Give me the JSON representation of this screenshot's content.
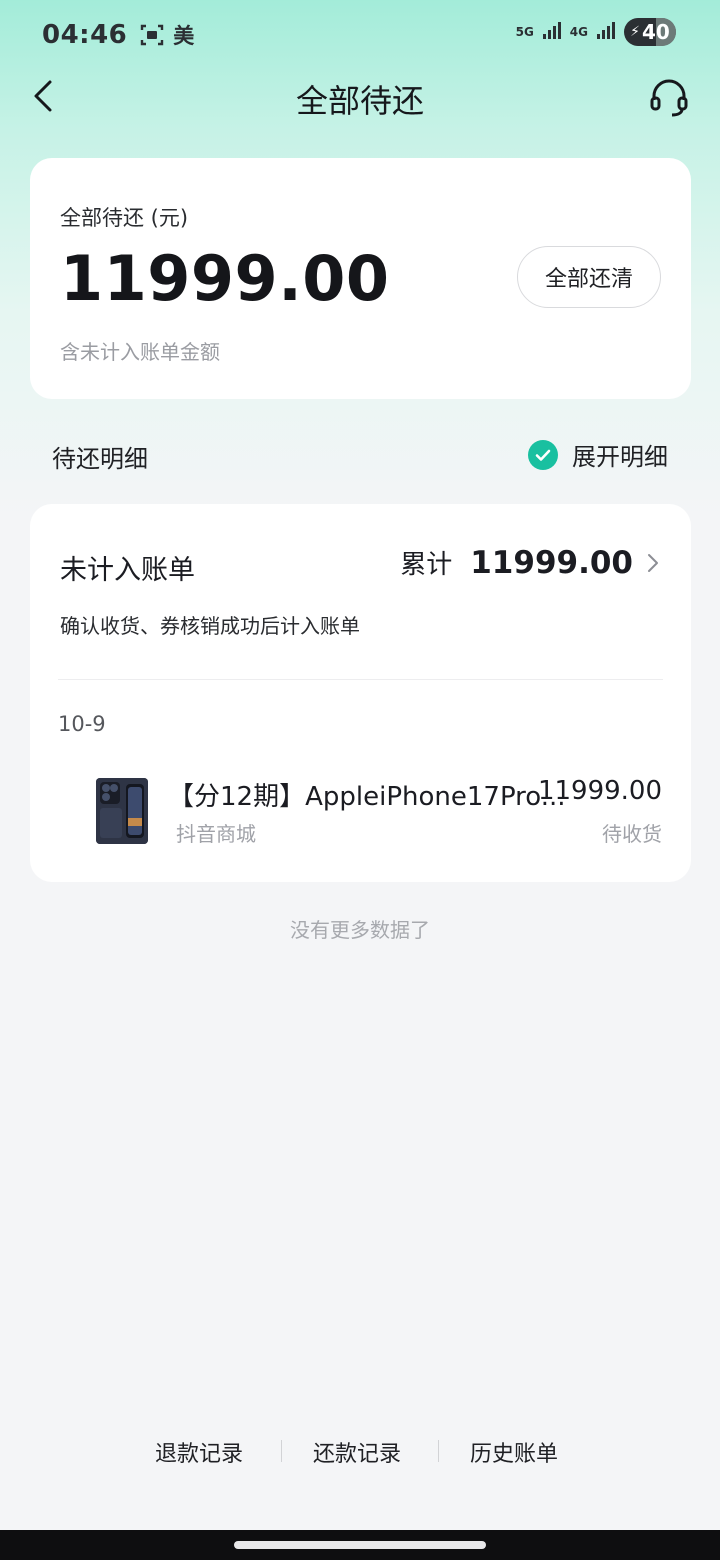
{
  "status_bar": {
    "time": "04:46",
    "app_indicator": "美",
    "network_1": "5G",
    "network_2": "4G",
    "battery": "40"
  },
  "header": {
    "title": "全部待还"
  },
  "summary": {
    "label": "全部待还 (元)",
    "amount": "11999.00",
    "note": "含未计入账单金额",
    "payoff_button": "全部还清"
  },
  "details_section": {
    "title": "待还明细",
    "toggle_label": "展开明细",
    "toggle_checked": true
  },
  "unbilled": {
    "title": "未计入账单",
    "total_label": "累计",
    "total_value": "11999.00",
    "subtitle": "确认收货、券核销成功后计入账单",
    "date": "10-9",
    "items": [
      {
        "name": "【分12期】AppleiPhone17Pro...",
        "price": "11999.00",
        "store": "抖音商城",
        "status": "待收货"
      }
    ]
  },
  "no_more_text": "没有更多数据了",
  "footer": {
    "refund_records": "退款记录",
    "repayment_records": "还款记录",
    "history_bills": "历史账单"
  },
  "colors": {
    "accent": "#19c0a0",
    "header_gradient_top": "#a3ecd9"
  }
}
